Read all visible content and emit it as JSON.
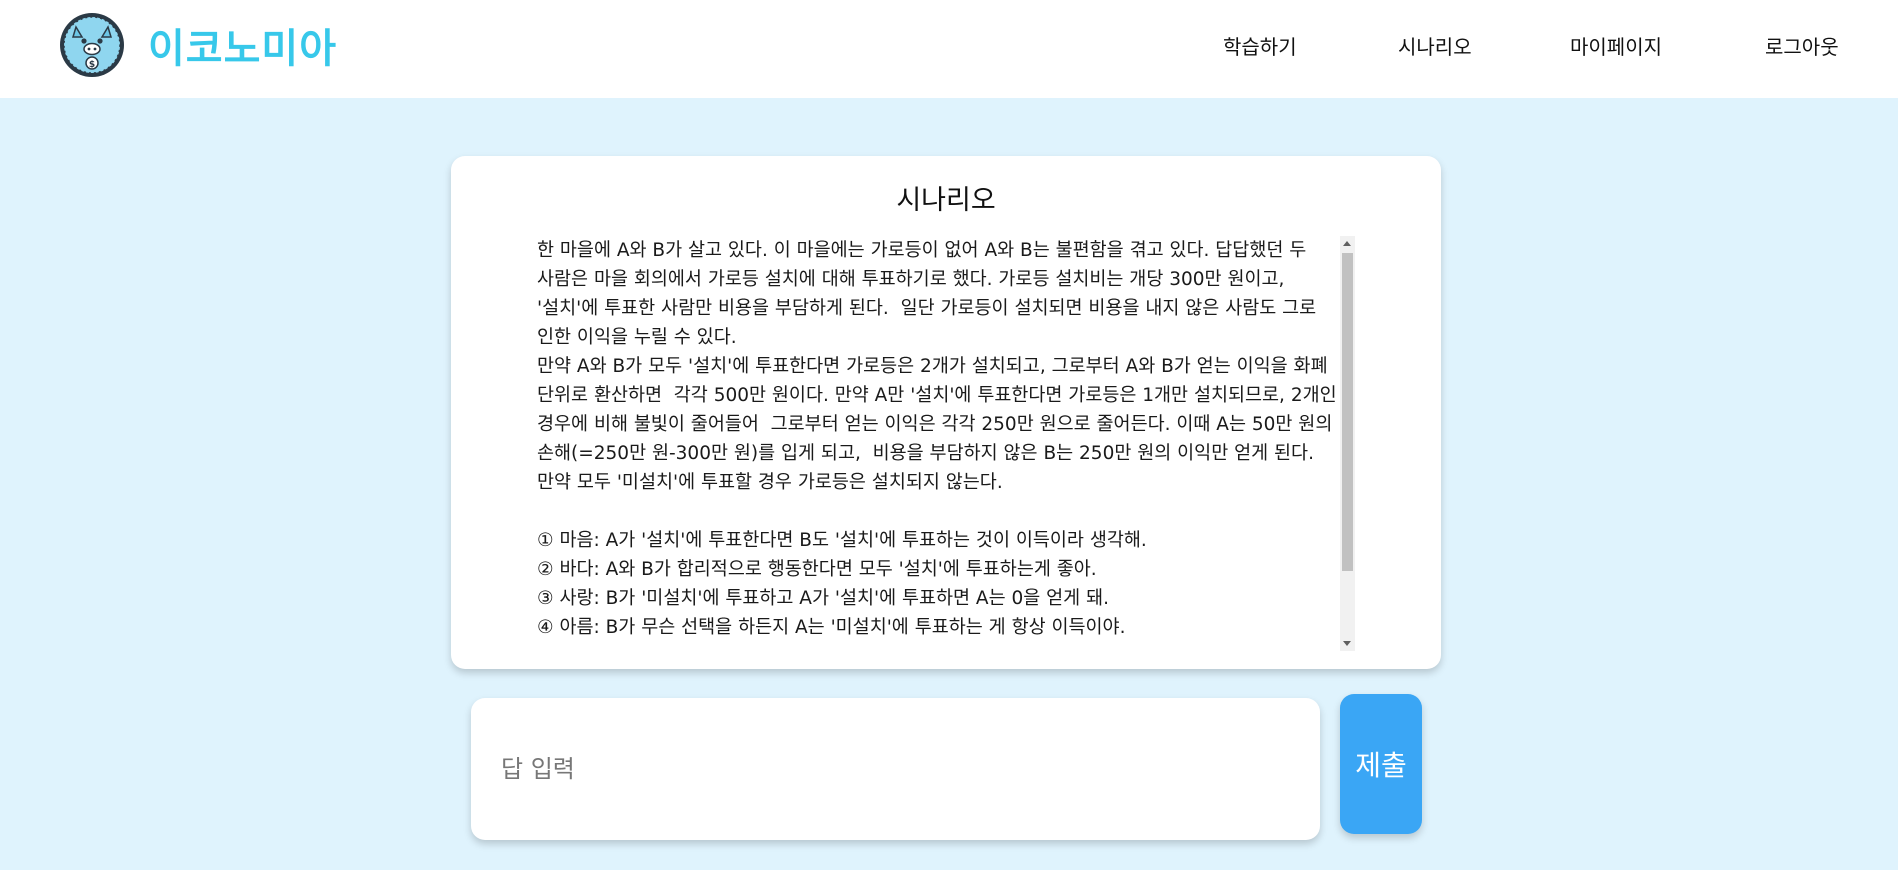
{
  "header": {
    "logo_text": "이코노미아",
    "nav": [
      "학습하기",
      "시나리오",
      "마이페이지",
      "로그아웃"
    ]
  },
  "scenario": {
    "title": "시나리오",
    "body": "한 마을에 A와 B가 살고 있다. 이 마을에는 가로등이 없어 A와 B는 불편함을 겪고 있다. 답답했던 두 사람은 마을 회의에서 가로등 설치에 대해 투표하기로 했다. 가로등 설치비는 개당 300만 원이고, '설치'에 투표한 사람만 비용을 부담하게 된다.  일단 가로등이 설치되면 비용을 내지 않은 사람도 그로 인한 이익을 누릴 수 있다.\n만약 A와 B가 모두 '설치'에 투표한다면 가로등은 2개가 설치되고, 그로부터 A와 B가 얻는 이익을 화폐 단위로 환산하면  각각 500만 원이다. 만약 A만 '설치'에 투표한다면 가로등은 1개만 설치되므로, 2개인 경우에 비해 불빛이 줄어들어  그로부터 얻는 이익은 각각 250만 원으로 줄어든다. 이때 A는 50만 원의 손해(=250만 원-300만 원)를 입게 되고,  비용을 부담하지 않은 B는 250만 원의 이익만 얻게 된다. 만약 모두 '미설치'에 투표할 경우 가로등은 설치되지 않는다.\n\n① 마음: A가 '설치'에 투표한다면 B도 '설치'에 투표하는 것이 이득이라 생각해.\n② 바다: A와 B가 합리적으로 행동한다면 모두 '설치'에 투표하는게 좋아.\n③ 사랑: B가 '미설치'에 투표하고 A가 '설치'에 투표하면 A는 0을 얻게 돼.\n④ 아름: B가 무슨 선택을 하든지 A는 '미설치'에 투표하는 게 항상 이득이야."
  },
  "answer": {
    "placeholder": "답 입력",
    "value": "",
    "submit_label": "제출"
  },
  "colors": {
    "background": "#dff3fd",
    "brand": "#37c8ea",
    "submit": "#3aa6f5"
  }
}
